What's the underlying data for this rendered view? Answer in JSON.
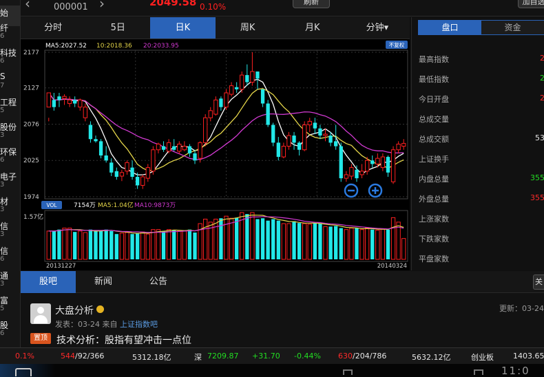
{
  "left_list": [
    {
      "name": "始",
      "sub": ""
    },
    {
      "name": "纤",
      "sub": "6"
    },
    {
      "name": "科技",
      "sub": "6"
    },
    {
      "name": "S",
      "sub": "7"
    },
    {
      "name": "工程",
      "sub": "5"
    },
    {
      "name": "股份",
      "sub": "3"
    },
    {
      "name": "环保",
      "sub": "6"
    },
    {
      "name": "电子",
      "sub": "3"
    },
    {
      "name": "材",
      "sub": "3"
    },
    {
      "name": "信",
      "sub": "3"
    },
    {
      "name": "信",
      "sub": "6"
    },
    {
      "name": "通",
      "sub": "3"
    },
    {
      "name": "富",
      "sub": "5"
    },
    {
      "name": "股",
      "sub": "6"
    }
  ],
  "header": {
    "code": "000001",
    "price": "2049.58",
    "change_pct": "0.10%",
    "refresh_label": "刷新",
    "add_label": "加自选"
  },
  "period_tabs": [
    "分时",
    "5日",
    "日K",
    "周K",
    "月K",
    "分钟▾"
  ],
  "chart_data": {
    "type": "candlestick",
    "adjust_badge": "不复权",
    "ma_labels": {
      "ma5": "MA5:2027.52",
      "ma10": "10:2018.36",
      "ma20": "20:2033.95"
    },
    "y_ticks": [
      "2177",
      "2127",
      "2076",
      "2025",
      "1974"
    ],
    "ylim": [
      1974,
      2177
    ],
    "volume_label": "VOL",
    "volume_info": {
      "vol": "7154万",
      "ma5": "MA5:1.04亿",
      "ma10": "MA10:9873万"
    },
    "volume_max_label": "1.57亿",
    "volume_max": 1.57,
    "start_date": "20131227",
    "end_date": "20140324",
    "colors": {
      "up": "#ff2020",
      "down": "#22e8e8",
      "ma5": "#ffffff",
      "ma10": "#e5d64a",
      "ma20": "#d23ad2"
    },
    "candles": [
      [
        2100,
        2120,
        2085,
        2080
      ],
      [
        2110,
        2100,
        2120,
        2095
      ],
      [
        2115,
        2110,
        2120,
        2100
      ],
      [
        2112,
        2115,
        2118,
        2103
      ],
      [
        2105,
        2110,
        2115,
        2100
      ],
      [
        2110,
        2105,
        2115,
        2100
      ],
      [
        2100,
        2110,
        2112,
        2095
      ],
      [
        2085,
        2100,
        2105,
        2080
      ],
      [
        2075,
        2055,
        2080,
        2050
      ],
      [
        2055,
        2052,
        2060,
        2050
      ],
      [
        2052,
        2032,
        2055,
        2028
      ],
      [
        2032,
        2025,
        2045,
        2022
      ],
      [
        2022,
        2008,
        2028,
        2003
      ],
      [
        2010,
        2002,
        2015,
        1998
      ],
      [
        2003,
        2008,
        2012,
        1996
      ],
      [
        2010,
        2022,
        2025,
        2005
      ],
      [
        2015,
        2002,
        2025,
        1998
      ],
      [
        2002,
        1990,
        2008,
        1985
      ],
      [
        1990,
        2002,
        2005,
        1985
      ],
      [
        2000,
        2015,
        2020,
        1995
      ],
      [
        2010,
        2040,
        2045,
        2005
      ],
      [
        2040,
        2048,
        2050,
        2035
      ],
      [
        2045,
        2040,
        2052,
        2037
      ],
      [
        2038,
        2050,
        2055,
        2035
      ],
      [
        2045,
        2040,
        2055,
        2038
      ],
      [
        2038,
        2048,
        2052,
        2034
      ],
      [
        2040,
        2045,
        2052,
        2038
      ],
      [
        2045,
        2035,
        2048,
        2030
      ],
      [
        2035,
        2025,
        2040,
        2020
      ],
      [
        2028,
        2050,
        2052,
        2022
      ],
      [
        2050,
        2085,
        2090,
        2045
      ],
      [
        2085,
        2095,
        2100,
        2080
      ],
      [
        2090,
        2110,
        2115,
        2088
      ],
      [
        2112,
        2100,
        2115,
        2095
      ],
      [
        2100,
        2120,
        2125,
        2096
      ],
      [
        2118,
        2130,
        2135,
        2115
      ],
      [
        2128,
        2125,
        2135,
        2120
      ],
      [
        2125,
        2145,
        2150,
        2120
      ],
      [
        2145,
        2135,
        2160,
        2130
      ],
      [
        2135,
        2150,
        2177,
        2130
      ],
      [
        2150,
        2140,
        2150,
        2125
      ],
      [
        2125,
        2105,
        2125,
        2100
      ],
      [
        2105,
        2075,
        2110,
        2072
      ],
      [
        2075,
        2050,
        2078,
        2045
      ],
      [
        2050,
        2030,
        2058,
        2025
      ],
      [
        2030,
        2045,
        2050,
        2028
      ],
      [
        2045,
        2060,
        2065,
        2040
      ],
      [
        2060,
        2050,
        2065,
        2040
      ],
      [
        2050,
        2040,
        2052,
        2032
      ],
      [
        2040,
        2075,
        2080,
        2038
      ],
      [
        2075,
        2080,
        2085,
        2065
      ],
      [
        2078,
        2070,
        2085,
        2062
      ],
      [
        2070,
        2060,
        2075,
        2055
      ],
      [
        2060,
        2062,
        2070,
        2052
      ],
      [
        2060,
        2050,
        2065,
        2045
      ],
      [
        2052,
        2045,
        2075,
        2040
      ],
      [
        2045,
        2000,
        2050,
        1995
      ],
      [
        2000,
        2005,
        2010,
        1995
      ],
      [
        2003,
        2015,
        2020,
        1998
      ],
      [
        2012,
        2000,
        2018,
        1995
      ],
      [
        2005,
        2010,
        2020,
        2000
      ],
      [
        2010,
        2025,
        2030,
        2005
      ],
      [
        2025,
        2020,
        2032,
        2015
      ],
      [
        2020,
        2028,
        2035,
        2015
      ],
      [
        2015,
        2030,
        2035,
        2010
      ],
      [
        2030,
        2008,
        2032,
        2002
      ],
      [
        1995,
        2040,
        2045,
        1992
      ],
      [
        2040,
        2048,
        2052,
        2035
      ],
      [
        2045,
        2049,
        2055,
        2040
      ]
    ],
    "volumes": [
      0.95,
      0.95,
      1.0,
      1.05,
      1.05,
      0.92,
      0.95,
      0.9,
      1.0,
      0.98,
      0.95,
      1.0,
      0.95,
      0.85,
      0.88,
      0.9,
      0.85,
      0.88,
      0.92,
      0.85,
      1.0,
      1.0,
      0.95,
      1.0,
      0.98,
      0.95,
      0.95,
      1.0,
      0.9,
      1.2,
      1.35,
      1.25,
      1.35,
      1.38,
      1.45,
      1.38,
      1.4,
      1.57,
      1.52,
      1.57,
      1.35,
      1.38,
      1.3,
      1.35,
      1.3,
      1.2,
      1.2,
      1.28,
      1.22,
      1.2,
      1.18,
      1.22,
      1.2,
      1.1,
      1.1,
      1.12,
      1.05,
      1.0,
      1.05,
      1.05,
      1.0,
      1.05,
      1.0,
      0.98,
      1.02,
      1.0,
      1.4,
      1.25,
      0.7
    ]
  },
  "right_panel": {
    "tabs": [
      "盘口",
      "资金"
    ],
    "rows": [
      {
        "label": "最高指数",
        "value": "2",
        "color": "#ff2a2a"
      },
      {
        "label": "最低指数",
        "value": "2",
        "color": "#22dd22"
      },
      {
        "label": "今日开盘",
        "value": "2",
        "color": "#ff2a2a"
      },
      {
        "label": "总成交量",
        "value": "",
        "color": "#e6e6e6"
      },
      {
        "label": "总成交额",
        "value": "53",
        "color": "#e6e6e6"
      },
      {
        "label": "上证换手",
        "value": "",
        "color": "#e6e6e6"
      },
      {
        "label": "内盘总量",
        "value": "355",
        "color": "#22dd22"
      },
      {
        "label": "外盘总量",
        "value": "355",
        "color": "#ff2a2a"
      },
      {
        "label": "上涨家数",
        "value": "",
        "color": "#e6e6e6"
      },
      {
        "label": "下跌家数",
        "value": "",
        "color": "#e6e6e6"
      },
      {
        "label": "平盘家数",
        "value": "",
        "color": "#e6e6e6"
      }
    ]
  },
  "bottom_tabs": [
    "股吧",
    "新闻",
    "公告"
  ],
  "close_label": "关",
  "post": {
    "author": "大盘分析",
    "updated": "更新：03-24",
    "meta_prefix": "发表：03-24  来自",
    "meta_link": "上证指数吧",
    "pin_label": "置顶",
    "title": "技术分析：股指有望冲击一点位"
  },
  "ticker": {
    "sh_pct": "0.1%",
    "sh_up": "544",
    "sh_flat_down": "/92/366",
    "sh_amount": "5312.18亿",
    "sz_label": "深",
    "sz_index": "7209.87",
    "sz_change": "+31.70",
    "sz_pct": "-0.44%",
    "sz_up": "630",
    "sz_flat_down": "/204/786",
    "sz_amount": "5632.12亿",
    "cy_label": "创业板",
    "cy_index": "1403.65"
  },
  "clock": "11:0"
}
